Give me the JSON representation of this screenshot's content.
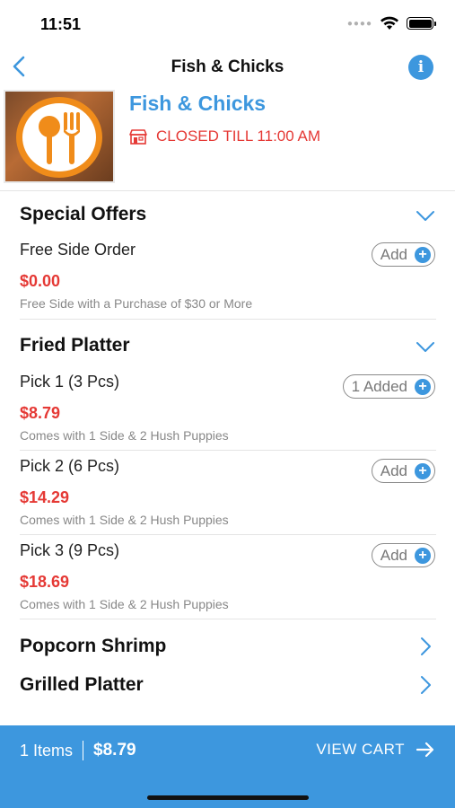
{
  "status_bar": {
    "time": "11:51"
  },
  "nav": {
    "title": "Fish & Chicks"
  },
  "restaurant": {
    "name": "Fish & Chicks",
    "status": "CLOSED TILL 11:00 AM"
  },
  "sections": [
    {
      "title": "Special Offers",
      "items": [
        {
          "name": "Free Side Order",
          "price": "$0.00",
          "desc": "Free Side with a Purchase of $30 or More",
          "button": "Add"
        }
      ]
    },
    {
      "title": "Fried Platter",
      "items": [
        {
          "name": "Pick 1 (3 Pcs)",
          "price": "$8.79",
          "desc": "Comes with 1 Side & 2 Hush Puppies",
          "button": "1 Added"
        },
        {
          "name": "Pick 2 (6 Pcs)",
          "price": "$14.29",
          "desc": "Comes with 1 Side & 2 Hush Puppies",
          "button": "Add"
        },
        {
          "name": "Pick 3 (9 Pcs)",
          "price": "$18.69",
          "desc": "Comes with 1 Side & 2 Hush Puppies",
          "button": "Add"
        }
      ]
    },
    {
      "title": "Popcorn Shrimp"
    },
    {
      "title": "Grilled Platter"
    }
  ],
  "cart": {
    "count": "1 Items",
    "total": "$8.79",
    "action": "VIEW CART"
  },
  "colors": {
    "accent": "#3d97de",
    "price": "#e53935",
    "logo_ring": "#f08c1a"
  }
}
